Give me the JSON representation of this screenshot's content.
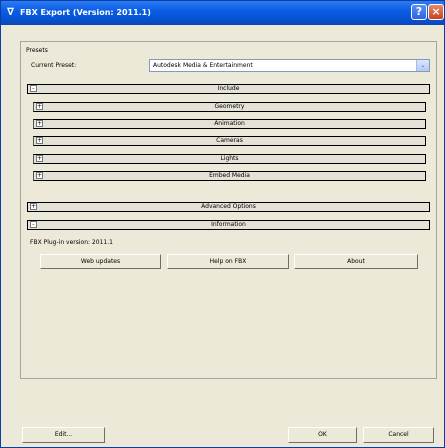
{
  "window": {
    "title": "FBX Export (Version: 2011.1)",
    "help_glyph": "?",
    "close_glyph": "×",
    "app_glyph": "∇"
  },
  "presets": {
    "group_label": "Presets",
    "current_label": "Current Preset:",
    "current_value": "Autodesk Media & Entertainment",
    "dropdown_glyph": "⌄"
  },
  "include": {
    "toggle": "-",
    "title": "Include",
    "items": [
      {
        "toggle": "+",
        "label": "Geometry"
      },
      {
        "toggle": "+",
        "label": "Animation"
      },
      {
        "toggle": "+",
        "label": "Cameras"
      },
      {
        "toggle": "+",
        "label": "Lights"
      },
      {
        "toggle": "+",
        "label": "Embed Media"
      }
    ]
  },
  "advanced": {
    "toggle": "+",
    "title": "Advanced Options"
  },
  "information": {
    "toggle": "-",
    "title": "Information",
    "plugin_version": "FBX Plug-in version: 2011.1",
    "buttons": {
      "web_updates": "Web updates",
      "help": "Help on FBX",
      "about": "About"
    }
  },
  "footer": {
    "edit": "Edit...",
    "ok": "OK",
    "cancel": "Cancel"
  }
}
